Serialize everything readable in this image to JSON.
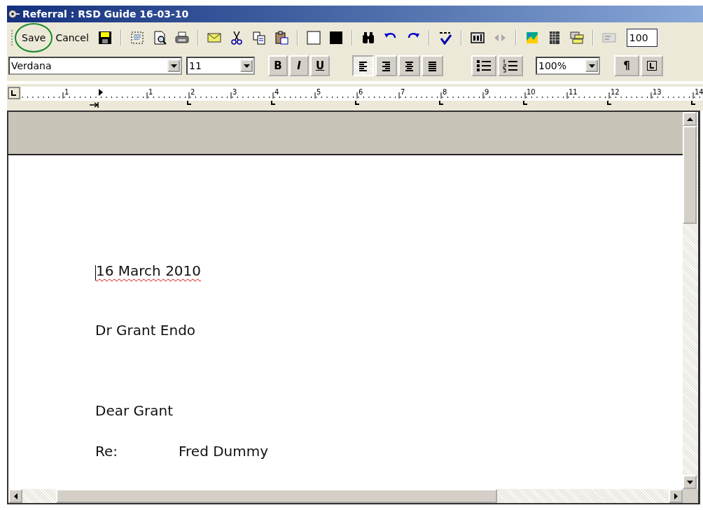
{
  "window": {
    "title": "Referral : RSD Guide 16-03-10"
  },
  "toolbar": {
    "buttons": [
      {
        "label": "Save",
        "highlighted": true
      },
      {
        "label": "Cancel",
        "highlighted": false
      }
    ],
    "zoom": "100"
  },
  "format_bar": {
    "font": "Verdana",
    "size": "11",
    "styles": [
      {
        "kind": "bold",
        "label": "B",
        "selected": false
      },
      {
        "kind": "italic",
        "label": "I",
        "selected": false
      },
      {
        "kind": "underline",
        "label": "U",
        "selected": false
      }
    ],
    "alignment": [
      {
        "kind": "left",
        "selected": true
      },
      {
        "kind": "right",
        "selected": false
      },
      {
        "kind": "center",
        "selected": false
      },
      {
        "kind": "justify",
        "selected": false
      }
    ],
    "lists": [
      {
        "kind": "bullets",
        "selected": false
      },
      {
        "kind": "numbers",
        "selected": false
      }
    ],
    "zoom": "100%",
    "marks": {
      "label": "¶",
      "selected": false
    }
  },
  "ruler": {
    "labels": [
      "1",
      "1",
      "2",
      "3",
      "4",
      "5",
      "6",
      "7",
      "8",
      "9",
      "10",
      "11",
      "12",
      "13",
      "14"
    ]
  },
  "document": {
    "lines": [
      {
        "text": "16 March 2010",
        "misspelled": true,
        "caret": true
      },
      {
        "text": "Dr Grant Endo",
        "misspelled": false,
        "caret": false
      },
      {
        "text": "Dear Grant",
        "misspelled": false,
        "caret": false
      },
      {
        "label": "Re:",
        "text": "Fred Dummy",
        "misspelled": false,
        "caret": false
      }
    ]
  }
}
